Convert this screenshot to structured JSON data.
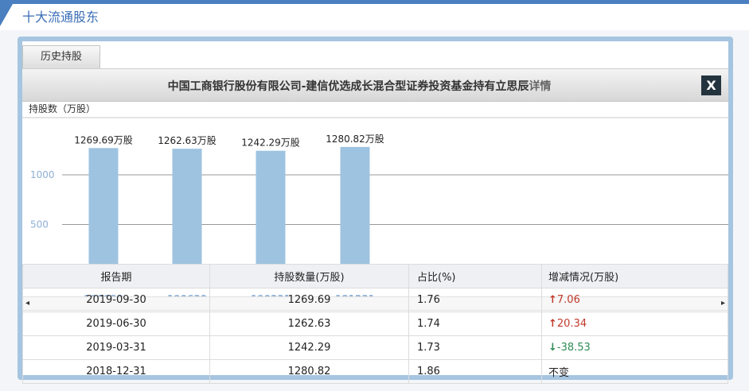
{
  "section": {
    "title": "十大流通股东"
  },
  "tab": {
    "label": "历史持股"
  },
  "dialog": {
    "title": "中国工商银行股份有限公司-建信优选成长混合型证券投资基金持有立思辰",
    "detail_label": "详情",
    "close_label": "X"
  },
  "chart_data": {
    "type": "bar",
    "ylabel": "持股数（万股）",
    "categories": [
      "190930",
      "190630",
      "190331",
      "181231"
    ],
    "values": [
      1269.69,
      1262.63,
      1242.29,
      1280.82
    ],
    "value_labels": [
      "1269.69万股",
      "1262.63万股",
      "1242.29万股",
      "1280.82万股"
    ],
    "yticks": [
      "1000",
      "500"
    ],
    "ytick_values": [
      1000,
      500
    ],
    "ylim": [
      0,
      1600
    ],
    "grid": true,
    "bar_color": "#9ec3e0"
  },
  "table": {
    "headers": [
      "报告期",
      "持股数量(万股)",
      "占比(%)",
      "增减情况(万股)"
    ],
    "rows": [
      {
        "date": "2019-09-30",
        "shares": "1269.69",
        "ratio": "1.76",
        "change": "7.06",
        "dir": "up"
      },
      {
        "date": "2019-06-30",
        "shares": "1262.63",
        "ratio": "1.74",
        "change": "20.34",
        "dir": "up"
      },
      {
        "date": "2019-03-31",
        "shares": "1242.29",
        "ratio": "1.73",
        "change": "-38.53",
        "dir": "down"
      },
      {
        "date": "2018-12-31",
        "shares": "1280.82",
        "ratio": "1.86",
        "change": "不变",
        "dir": "none"
      }
    ]
  },
  "icons": {
    "up": "↑",
    "down": "↓",
    "scroll_left": "◂",
    "scroll_right": "▸"
  }
}
